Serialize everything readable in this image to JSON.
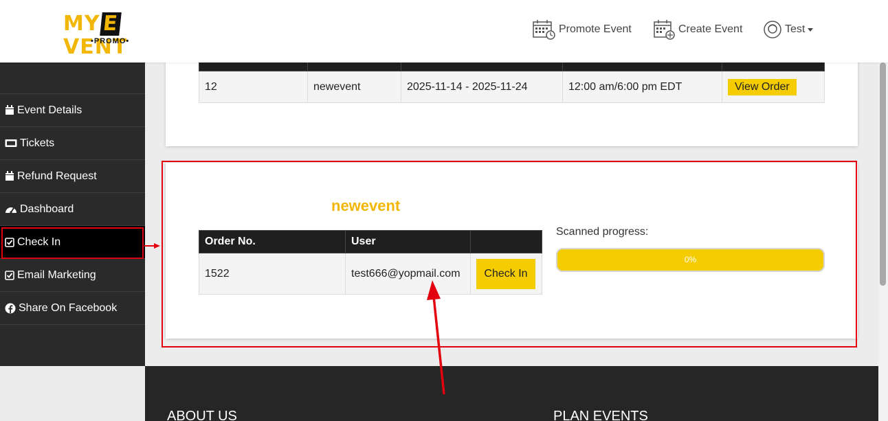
{
  "header": {
    "logo_top_left": "MY",
    "logo_e": "E",
    "logo_top_right": "VENT",
    "logo_sub": "•PROMO•",
    "nav": [
      {
        "label": "Promote Event",
        "icon": "calendar-clock-icon"
      },
      {
        "label": "Create Event",
        "icon": "calendar-plus-icon"
      },
      {
        "label": "Test",
        "icon": "user-avatar-icon"
      }
    ]
  },
  "sidebar": {
    "items": [
      {
        "label": "Event Details",
        "icon": "calendar-icon"
      },
      {
        "label": "Tickets",
        "icon": "ticket-icon"
      },
      {
        "label": "Refund Request",
        "icon": "calendar-icon"
      },
      {
        "label": "Dashboard",
        "icon": "gauge-icon"
      },
      {
        "label": "Check In",
        "icon": "checkbox-icon",
        "active": true
      },
      {
        "label": "Email Marketing",
        "icon": "checkbox-icon"
      },
      {
        "label": "Share On Facebook",
        "icon": "facebook-icon"
      }
    ]
  },
  "events_table": {
    "row": {
      "number": "12",
      "name": "newevent",
      "date": "2025-11-14 - 2025-11-24",
      "time": "12:00 am/6:00 pm EDT",
      "action": "View Order"
    }
  },
  "checkin": {
    "event_title": "newevent",
    "columns": [
      "Order No.",
      "User",
      ""
    ],
    "row": {
      "order_no": "1522",
      "user": "test666@yopmail.com",
      "action": "Check In"
    },
    "progress_label": "Scanned progress:",
    "progress_text": "0%",
    "progress_fraction": 0
  },
  "footer": {
    "about": "ABOUT US",
    "plan": "PLAN EVENTS"
  },
  "colors": {
    "accent": "#f5cc00",
    "annotation": "#e3000f",
    "sidebar_bg": "#2a2a2a"
  }
}
